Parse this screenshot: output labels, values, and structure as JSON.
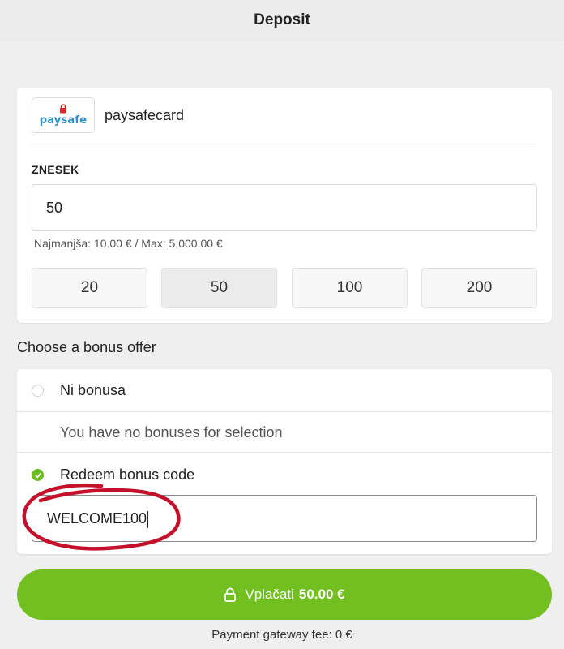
{
  "header": {
    "title": "Deposit"
  },
  "payment": {
    "logo_text": "paysafe",
    "method_name": "paysafecard",
    "amount_label": "ZNESEK",
    "amount_value": "50",
    "limits": "Najmanjša: 10.00 € / Max: 5,000.00 €",
    "quick_amounts": [
      "20",
      "50",
      "100",
      "200"
    ],
    "selected_quick": "50"
  },
  "bonus": {
    "title": "Choose a bonus offer",
    "no_bonus_label": "Ni bonusa",
    "empty_message": "You have no bonuses for selection",
    "redeem_label": "Redeem bonus code",
    "code_value": "WELCOME100"
  },
  "pay_button": {
    "label": "Vplačati",
    "amount": "50.00 €"
  },
  "fee": "Payment gateway fee: 0 €",
  "colors": {
    "accent_green": "#72c01f",
    "logo_blue": "#2d8fc8",
    "logo_red": "#d62828",
    "annotation": "#c4102a"
  }
}
